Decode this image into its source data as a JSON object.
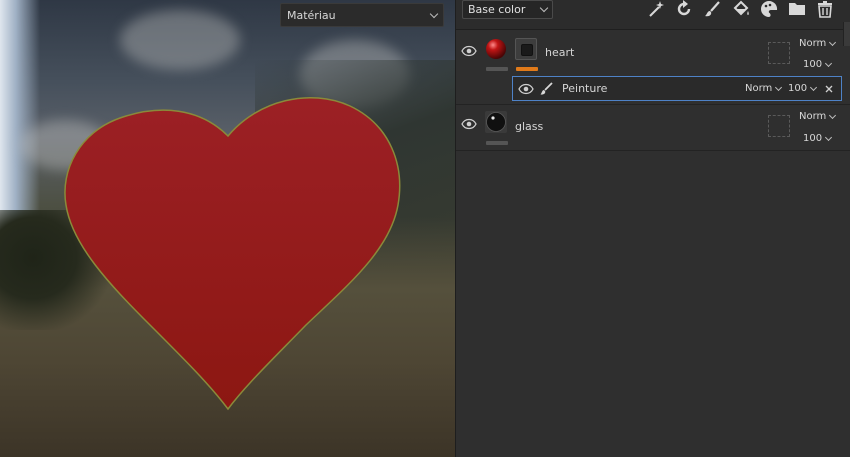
{
  "viewport": {
    "material_select": {
      "value": "Matériau"
    },
    "heart_color": "#9a1d1d",
    "heart_outline": "#8a8a3a"
  },
  "panel": {
    "toolbar": {
      "channel_select": {
        "value": "Base color"
      },
      "icons": [
        "magic-wand-icon",
        "refresh-icon",
        "brush-icon",
        "fill-bucket-icon",
        "palette-icon",
        "folder-icon",
        "trash-icon"
      ]
    },
    "layers": [
      {
        "name": "heart",
        "blend": "Norm",
        "opacity": "100",
        "material_color": "#c01515",
        "underline_color": "#e07a1a"
      },
      {
        "name": "glass",
        "blend": "Norm",
        "opacity": "100"
      }
    ],
    "sublayer": {
      "name": "Peinture",
      "blend": "Norm",
      "opacity": "100"
    }
  }
}
